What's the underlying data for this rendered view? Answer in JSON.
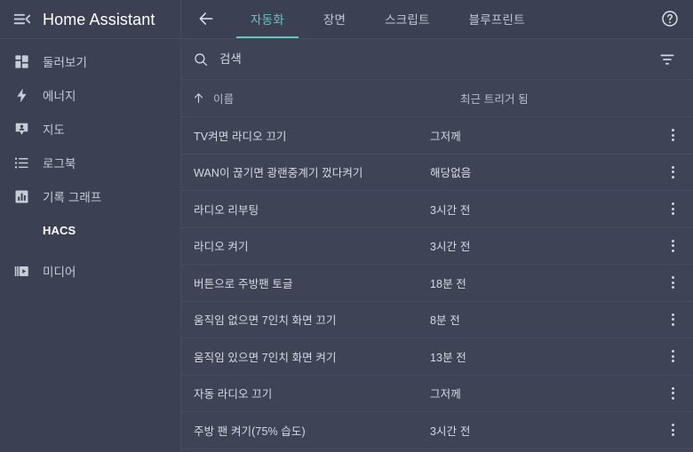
{
  "sidebar": {
    "menu_icon": "menu-close-icon",
    "brand_title": "Home Assistant",
    "items": [
      {
        "label": "둘러보기",
        "icon": "dashboard-grid-icon"
      },
      {
        "label": "에너지",
        "icon": "lightning-bolt-icon"
      },
      {
        "label": "지도",
        "icon": "map-marker-person-icon"
      },
      {
        "label": "로그북",
        "icon": "list-icon"
      },
      {
        "label": "기록 그래프",
        "icon": "bar-chart-icon"
      },
      {
        "label": "HACS",
        "icon": "none"
      },
      {
        "label": "미디어",
        "icon": "media-play-icon"
      }
    ]
  },
  "toolbar": {
    "back_icon": "arrow-left-icon",
    "help_icon": "help-circle-icon",
    "tabs": [
      {
        "label": "자동화",
        "active": true
      },
      {
        "label": "장면",
        "active": false
      },
      {
        "label": "스크립트",
        "active": false
      },
      {
        "label": "블루프린트",
        "active": false
      }
    ]
  },
  "search": {
    "placeholder": "검색",
    "value": "",
    "search_icon": "search-icon",
    "filter_icon": "filter-funnel-icon"
  },
  "table": {
    "columns": {
      "name": "이름",
      "last_triggered": "최근 트리거 됨"
    },
    "sort": {
      "column": "이름",
      "direction": "asc",
      "icon": "arrow-up-icon"
    },
    "row_menu_icon": "dots-vertical-icon",
    "rows": [
      {
        "name": "TV켜면 라디오 끄기",
        "last_triggered": "그저께"
      },
      {
        "name": "WAN이 끊기면 광랜중계기 껐다켜기",
        "last_triggered": "해당없음"
      },
      {
        "name": "라디오 리부팅",
        "last_triggered": "3시간 전"
      },
      {
        "name": "라디오 켜기",
        "last_triggered": "3시간 전"
      },
      {
        "name": "버튼으로 주방팬 토글",
        "last_triggered": "18분 전"
      },
      {
        "name": "움직임 없으면 7인치 화면 끄기",
        "last_triggered": "8분 전"
      },
      {
        "name": "움직임 있으면 7인치 화면 켜기",
        "last_triggered": "13분 전"
      },
      {
        "name": "자동 라디오 끄기",
        "last_triggered": "그저께"
      },
      {
        "name": "주방 팬 켜기(75% 습도)",
        "last_triggered": "3시간 전"
      }
    ]
  },
  "colors": {
    "sidebar_bg": "#3b4052",
    "content_bg": "#3e4356",
    "divider": "#474d60",
    "accent": "#62c5c0",
    "text_primary": "#ffffff",
    "text_secondary": "#c8ccd8"
  }
}
